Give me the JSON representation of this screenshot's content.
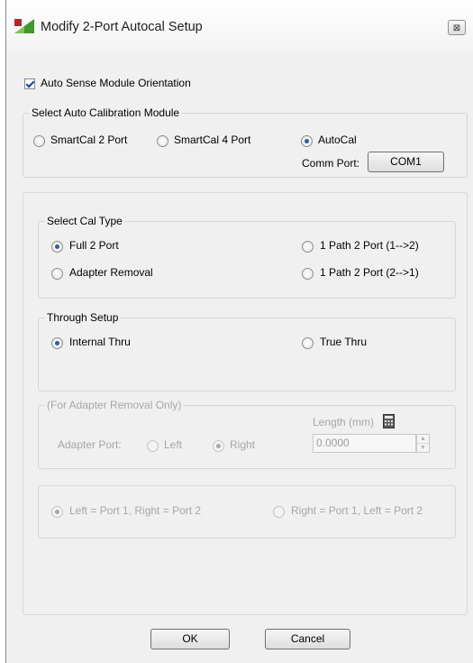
{
  "window": {
    "title": "Modify 2-Port Autocal Setup",
    "close_glyph": "⊠",
    "icon": "green-triangle-app-icon"
  },
  "auto_sense": {
    "label": "Auto Sense Module Orientation",
    "checked": true
  },
  "module_group": {
    "legend": "Select Auto Calibration Module",
    "options": [
      {
        "label": "SmartCal 2 Port",
        "selected": false
      },
      {
        "label": "SmartCal 4 Port",
        "selected": false
      },
      {
        "label": "AutoCal",
        "selected": true
      }
    ],
    "comm_port_label": "Comm Port:",
    "comm_port_button": "COM1"
  },
  "cal_type_group": {
    "legend": "Select Cal Type",
    "options": [
      {
        "label": "Full 2 Port",
        "selected": true
      },
      {
        "label": "Adapter Removal",
        "selected": false
      },
      {
        "label": "1 Path 2 Port (1-->2)",
        "selected": false
      },
      {
        "label": "1 Path 2 Port (2-->1)",
        "selected": false
      }
    ]
  },
  "through_group": {
    "legend": "Through Setup",
    "options": [
      {
        "label": "Internal Thru",
        "selected": true
      },
      {
        "label": "True Thru",
        "selected": false
      }
    ]
  },
  "adapter_group": {
    "legend": "(For Adapter Removal Only)",
    "adapter_port_label": "Adapter Port:",
    "options": [
      {
        "label": "Left",
        "selected": false
      },
      {
        "label": "Right",
        "selected": true
      }
    ],
    "length_label": "Length (mm)",
    "length_value": "0.0000",
    "spin_up": "▲",
    "spin_down": "▼"
  },
  "port_map_group": {
    "options": [
      {
        "label": "Left = Port 1, Right = Port 2",
        "selected": true
      },
      {
        "label": "Right = Port 1, Left = Port 2",
        "selected": false
      }
    ]
  },
  "buttons": {
    "ok": "OK",
    "cancel": "Cancel"
  },
  "colors": {
    "dialog_bg": "#f0f0f0",
    "radio_accent": "#2b5fa6",
    "disabled_text": "#a6a6a6",
    "title_icon_green": "#3f9a2e"
  }
}
